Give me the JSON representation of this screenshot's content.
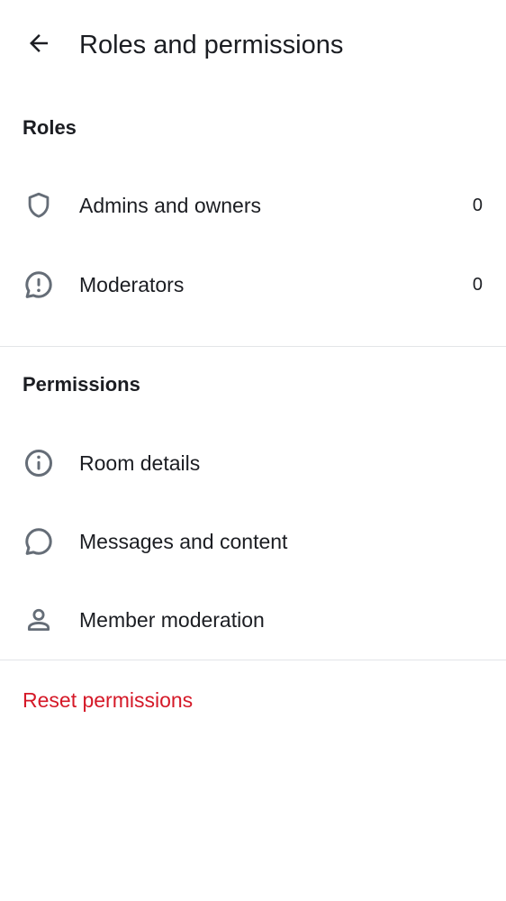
{
  "header": {
    "title": "Roles and permissions",
    "back_icon": "arrow-left-icon"
  },
  "roles": {
    "heading": "Roles",
    "items": [
      {
        "label": "Admins and owners",
        "count": "0",
        "icon": "shield-icon"
      },
      {
        "label": "Moderators",
        "count": "0",
        "icon": "alert-chat-icon"
      }
    ]
  },
  "permissions": {
    "heading": "Permissions",
    "items": [
      {
        "label": "Room details",
        "icon": "info-icon"
      },
      {
        "label": "Messages and content",
        "icon": "chat-bubble-icon"
      },
      {
        "label": "Member moderation",
        "icon": "user-icon"
      }
    ]
  },
  "reset": {
    "label": "Reset permissions",
    "color": "#d51928"
  },
  "colors": {
    "text": "#1b1d22",
    "icon": "#656d77",
    "divider": "#e3e5e8",
    "danger": "#d51928"
  }
}
